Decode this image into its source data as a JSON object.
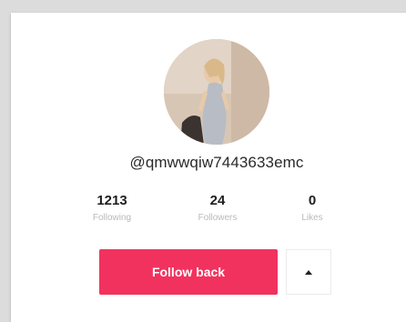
{
  "profile": {
    "username": "@qmwwqiw7443633emc"
  },
  "stats": [
    {
      "value": "1213",
      "label": "Following"
    },
    {
      "value": "24",
      "label": "Followers"
    },
    {
      "value": "0",
      "label": "Likes"
    }
  ],
  "actions": {
    "follow_label": "Follow back",
    "more_icon": "caret-up-icon"
  },
  "colors": {
    "accent": "#f2325e",
    "text": "#1e1e1e",
    "muted": "#b9b9b9"
  }
}
